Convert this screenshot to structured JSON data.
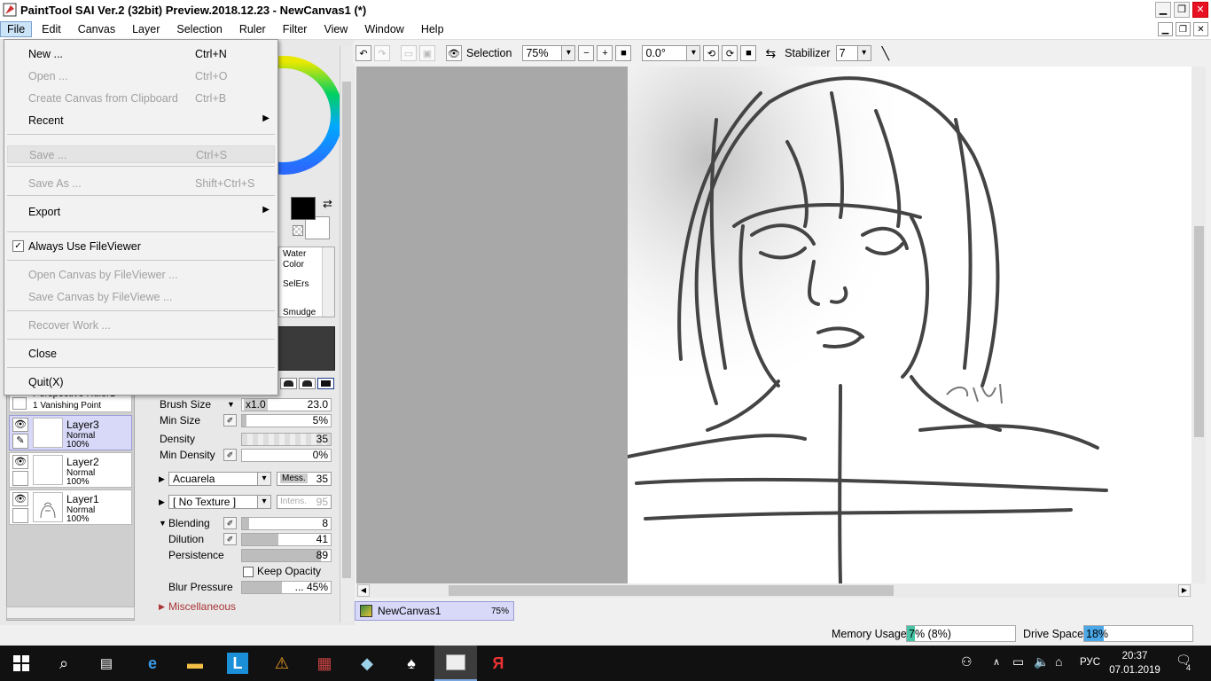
{
  "window": {
    "title": "PaintTool SAI Ver.2 (32bit) Preview.2018.12.23 - NewCanvas1 (*)"
  },
  "menubar": {
    "items": [
      "File",
      "Edit",
      "Canvas",
      "Layer",
      "Selection",
      "Ruler",
      "Filter",
      "View",
      "Window",
      "Help"
    ]
  },
  "file_menu": {
    "new": {
      "label": "New ...",
      "shortcut": "Ctrl+N"
    },
    "open": {
      "label": "Open ...",
      "shortcut": "Ctrl+O"
    },
    "create_clip": {
      "label": "Create Canvas from Clipboard",
      "shortcut": "Ctrl+B"
    },
    "recent": {
      "label": "Recent"
    },
    "save": {
      "label": "Save ...",
      "shortcut": "Ctrl+S"
    },
    "save_as": {
      "label": "Save As ...",
      "shortcut": "Shift+Ctrl+S"
    },
    "export": {
      "label": "Export"
    },
    "always_fileviewer": {
      "label": "Always Use FileViewer",
      "checked": true
    },
    "open_fileviewer": {
      "label": "Open Canvas by FileViewer ..."
    },
    "save_fileviewer": {
      "label": "Save Canvas by FileViewe ..."
    },
    "recover": {
      "label": "Recover Work ..."
    },
    "close": {
      "label": "Close"
    },
    "quit": {
      "label": "Quit(X)"
    }
  },
  "toolbar": {
    "selection_label": "Selection",
    "zoom": "75%",
    "rotation": "0.0°",
    "stabilizer_label": "Stabilizer",
    "stabilizer_value": "7"
  },
  "tools": {
    "water_color": "Water Color",
    "selers": "SelErs",
    "smudge": "Smudge"
  },
  "brush": {
    "brush_size_label": "Brush Size",
    "brush_size_mult": "x1.0",
    "brush_size_value": "23.0",
    "min_size_label": "Min Size",
    "min_size_value": "5%",
    "min_size_frac": 0.05,
    "density_label": "Density",
    "density_value": "35",
    "min_density_label": "Min Density",
    "min_density_value": "0%",
    "shape": "Acuarela",
    "shape_param_label": "Mess.",
    "shape_param_value": "35",
    "texture": "[ No Texture ]",
    "texture_param_label": "Intens.",
    "texture_param_value": "95",
    "blending_label": "Blending",
    "blending_value": "8",
    "blending_frac": 0.08,
    "dilution_label": "Dilution",
    "dilution_value": "41",
    "dilution_frac": 0.41,
    "persistence_label": "Persistence",
    "persistence_value": "89",
    "persistence_frac": 0.89,
    "keep_opacity_label": "Keep Opacity",
    "blur_pressure_label": "Blur Pressure",
    "blur_pressure_value": "... 45%",
    "blur_pressure_frac": 0.45,
    "misc_label": "Miscellaneous"
  },
  "layers": {
    "perspective": {
      "name": "Perspective Ruler1",
      "sub": "1 Vanishing Point"
    },
    "items": [
      {
        "name": "Layer3",
        "mode": "Normal",
        "opacity": "100%"
      },
      {
        "name": "Layer2",
        "mode": "Normal",
        "opacity": "100%"
      },
      {
        "name": "Layer1",
        "mode": "Normal",
        "opacity": "100%"
      }
    ]
  },
  "document_tab": {
    "name": "NewCanvas1",
    "zoom": "75%"
  },
  "status": {
    "memory_label": "Memory Usage",
    "memory_value": "7% (8%)",
    "memory_frac": 0.07,
    "drive_label": "Drive Space",
    "drive_value": "18%",
    "drive_frac": 0.18
  },
  "taskbar": {
    "language": "РУС",
    "time": "20:37",
    "date": "07.01.2019",
    "notifications": "4"
  },
  "colors": {
    "menu_highlight": "#cce4f7",
    "layer_selected": "#d8d8f8",
    "meter_memory": "#45c5a5",
    "meter_drive": "#4aa8e8"
  }
}
